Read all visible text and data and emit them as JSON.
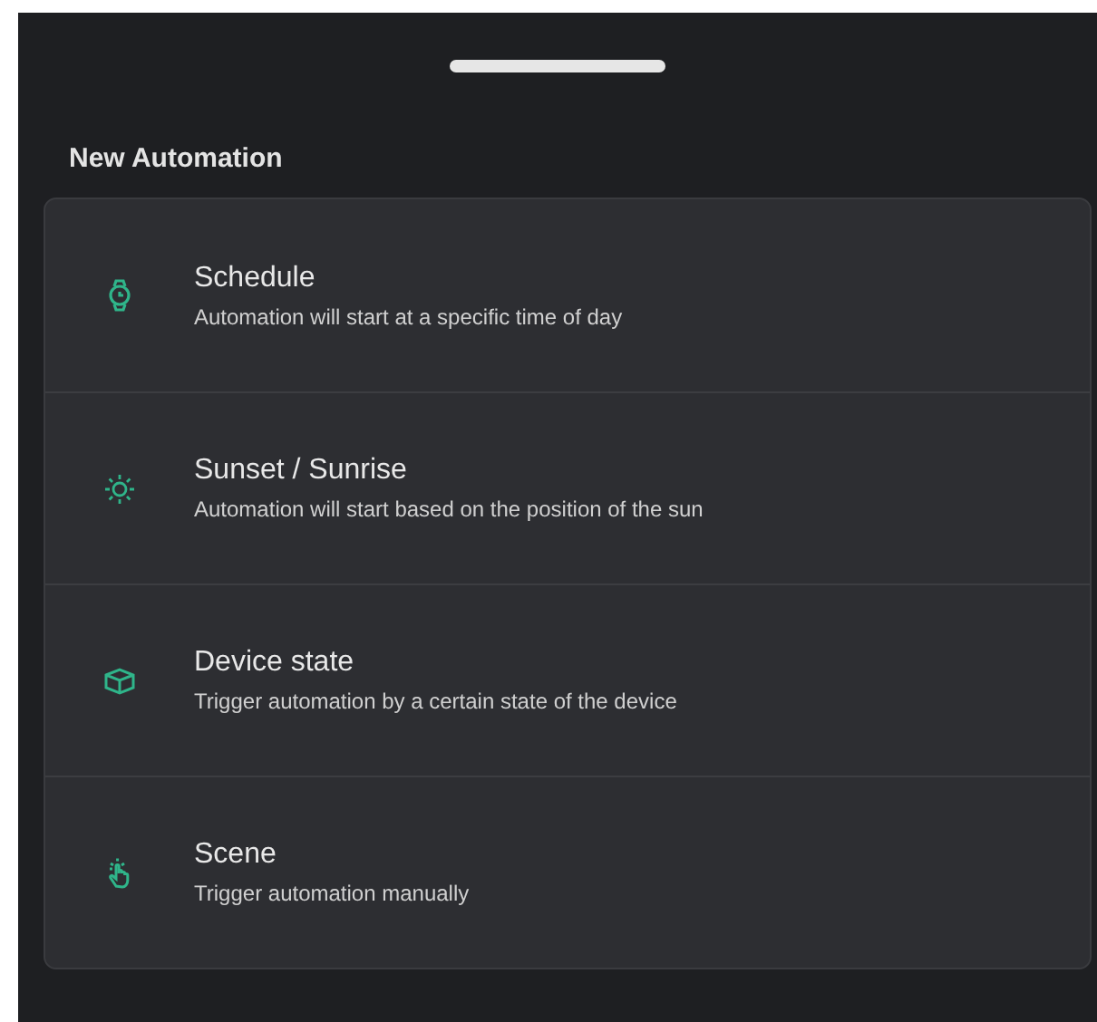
{
  "sheet": {
    "title": "New Automation"
  },
  "options": [
    {
      "kind": "schedule",
      "title": "Schedule",
      "description": "Automation will start at a specific time of day"
    },
    {
      "kind": "sun",
      "title": "Sunset / Sunrise",
      "description": "Automation will start based on the position of the sun"
    },
    {
      "kind": "device",
      "title": "Device state",
      "description": "Trigger automation by a certain state of the device"
    },
    {
      "kind": "scene",
      "title": "Scene",
      "description": "Trigger automation manually"
    }
  ]
}
